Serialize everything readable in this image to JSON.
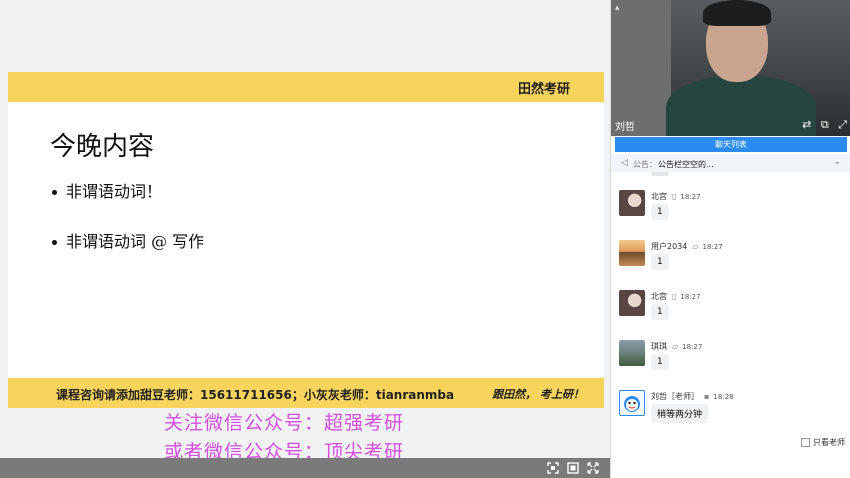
{
  "slide": {
    "brand": "田然考研",
    "title": "今晚内容",
    "bullets": [
      "非谓语动词！",
      "非谓语动词 @ 写作"
    ],
    "footer_contact": "课程咨询请添加甜豆老师：15611711656；小灰灰老师：tianranmba",
    "footer_slogan": "跟田然， 考上研！"
  },
  "watermark": {
    "line1": "关注微信公众号：超强考研",
    "line2": "或者微信公众号：顶尖考研"
  },
  "video": {
    "presenter_name": "刘哲"
  },
  "chat": {
    "tab_label": "聊天列表",
    "notice_label": "公告：",
    "notice_text": "公告栏空空的...",
    "messages": [
      {
        "user": "北宫",
        "time": "18:27",
        "text": "1"
      },
      {
        "user": "用户2034",
        "time": "18:27",
        "text": "1"
      },
      {
        "user": "北宫",
        "time": "18:27",
        "text": "1"
      },
      {
        "user": "琪琪",
        "time": "18:27",
        "text": "1"
      },
      {
        "user": "刘哲［老师］",
        "time": "18:28",
        "text": "稍等两分钟"
      }
    ],
    "only_teacher_label": "只看老师"
  },
  "icons": {
    "notice": "megaphone-icon",
    "device": "phone-icon",
    "switch": "switch-camera-icon",
    "popout": "popout-icon",
    "expand": "expand-icon",
    "fullscreen": "fullscreen-icon"
  }
}
